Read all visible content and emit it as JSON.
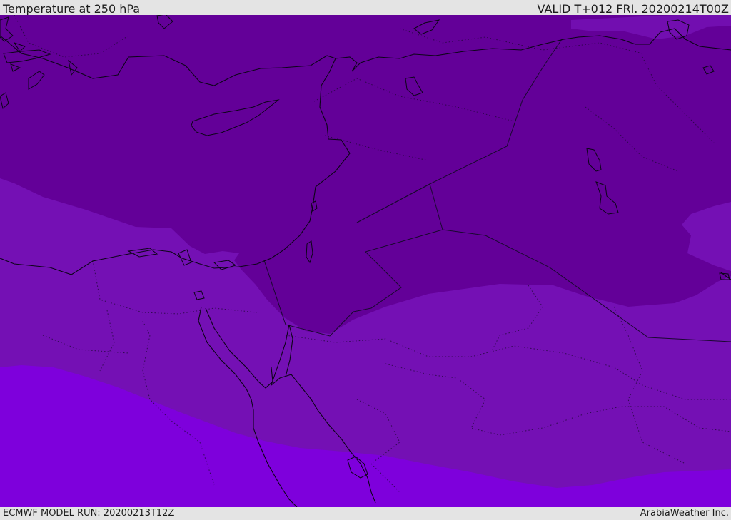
{
  "header": {
    "title": "Temperature at 250 hPa",
    "valid": "VALID T+012 FRI. 20200214T00Z"
  },
  "footer": {
    "model_run": "ECMWF MODEL RUN: 20200213T12Z",
    "credit": "ArabiaWeather Inc."
  },
  "colors": {
    "band_cold_dark": "#630098",
    "band_mid": "#7410b4",
    "band_warm": "#7e00dc",
    "coastline": "#0c0418"
  },
  "icons": []
}
